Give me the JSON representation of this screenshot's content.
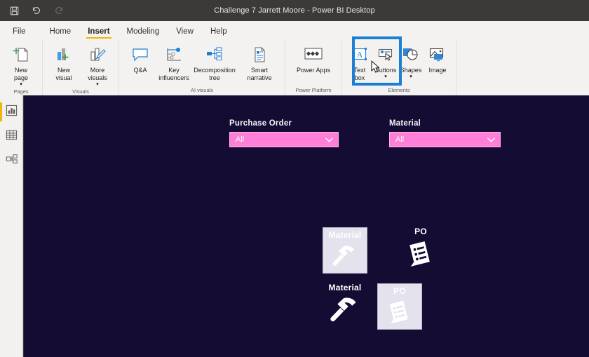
{
  "window": {
    "title": "Challenge 7 Jarrett Moore - Power BI Desktop"
  },
  "quick_access": [
    {
      "name": "save",
      "label": "Save",
      "icon": "save-icon",
      "disabled": false
    },
    {
      "name": "undo",
      "label": "Undo",
      "icon": "undo-icon",
      "disabled": false
    },
    {
      "name": "redo",
      "label": "Redo",
      "icon": "redo-icon",
      "disabled": true
    }
  ],
  "menu_tabs": [
    {
      "label": "File",
      "active": false
    },
    {
      "label": "Home",
      "active": false
    },
    {
      "label": "Insert",
      "active": true
    },
    {
      "label": "Modeling",
      "active": false
    },
    {
      "label": "View",
      "active": false
    },
    {
      "label": "Help",
      "active": false
    }
  ],
  "ribbon": {
    "groups": [
      {
        "label": "Pages",
        "items": [
          {
            "label": "New\npage",
            "icon": "new-page-icon",
            "has_caret": true
          }
        ]
      },
      {
        "label": "Visuals",
        "items": [
          {
            "label": "New\nvisual",
            "icon": "new-visual-icon",
            "has_caret": false
          },
          {
            "label": "More\nvisuals",
            "icon": "more-visuals-icon",
            "has_caret": true
          }
        ]
      },
      {
        "label": "AI visuals",
        "items": [
          {
            "label": "Q&A",
            "icon": "qna-icon",
            "has_caret": false
          },
          {
            "label": "Key\ninfluencers",
            "icon": "key-influencers-icon",
            "has_caret": false
          },
          {
            "label": "Decomposition\ntree",
            "icon": "decomposition-tree-icon",
            "has_caret": false
          },
          {
            "label": "Smart\nnarrative",
            "icon": "smart-narrative-icon",
            "has_caret": false
          }
        ]
      },
      {
        "label": "Power Platform",
        "items": [
          {
            "label": "Power Apps",
            "icon": "power-apps-icon",
            "has_caret": false
          }
        ]
      },
      {
        "label": "Elements",
        "items": [
          {
            "label": "Text\nbox",
            "icon": "text-box-icon",
            "has_caret": false
          },
          {
            "label": "Buttons",
            "icon": "buttons-icon",
            "has_caret": true
          },
          {
            "label": "Shapes",
            "icon": "shapes-icon",
            "has_caret": true
          },
          {
            "label": "Image",
            "icon": "image-icon",
            "has_caret": false
          }
        ]
      }
    ],
    "highlighted_item": "Image",
    "highlight_color": "#1d7fd3"
  },
  "left_rail": [
    {
      "name": "report-view",
      "icon": "report-bar-chart-icon",
      "active": true
    },
    {
      "name": "data-view",
      "icon": "data-table-icon",
      "active": false
    },
    {
      "name": "model-view",
      "icon": "model-relationships-icon",
      "active": false
    }
  ],
  "canvas": {
    "background_color": "#140c33",
    "slicers": [
      {
        "title": "Purchase Order",
        "value": "All",
        "accent_color": "#ff7fd8"
      },
      {
        "title": "Material",
        "value": "All",
        "accent_color": "#ff7fd8"
      }
    ],
    "images": [
      {
        "caption": "Material",
        "art": "hammer-icon",
        "framed": true
      },
      {
        "caption": "PO",
        "art": "purchase-order-doc-icon",
        "framed": false
      },
      {
        "caption": "Material",
        "art": "hammer-icon",
        "framed": false
      },
      {
        "caption": "PO",
        "art": "purchase-order-doc-icon",
        "framed": true
      }
    ]
  }
}
